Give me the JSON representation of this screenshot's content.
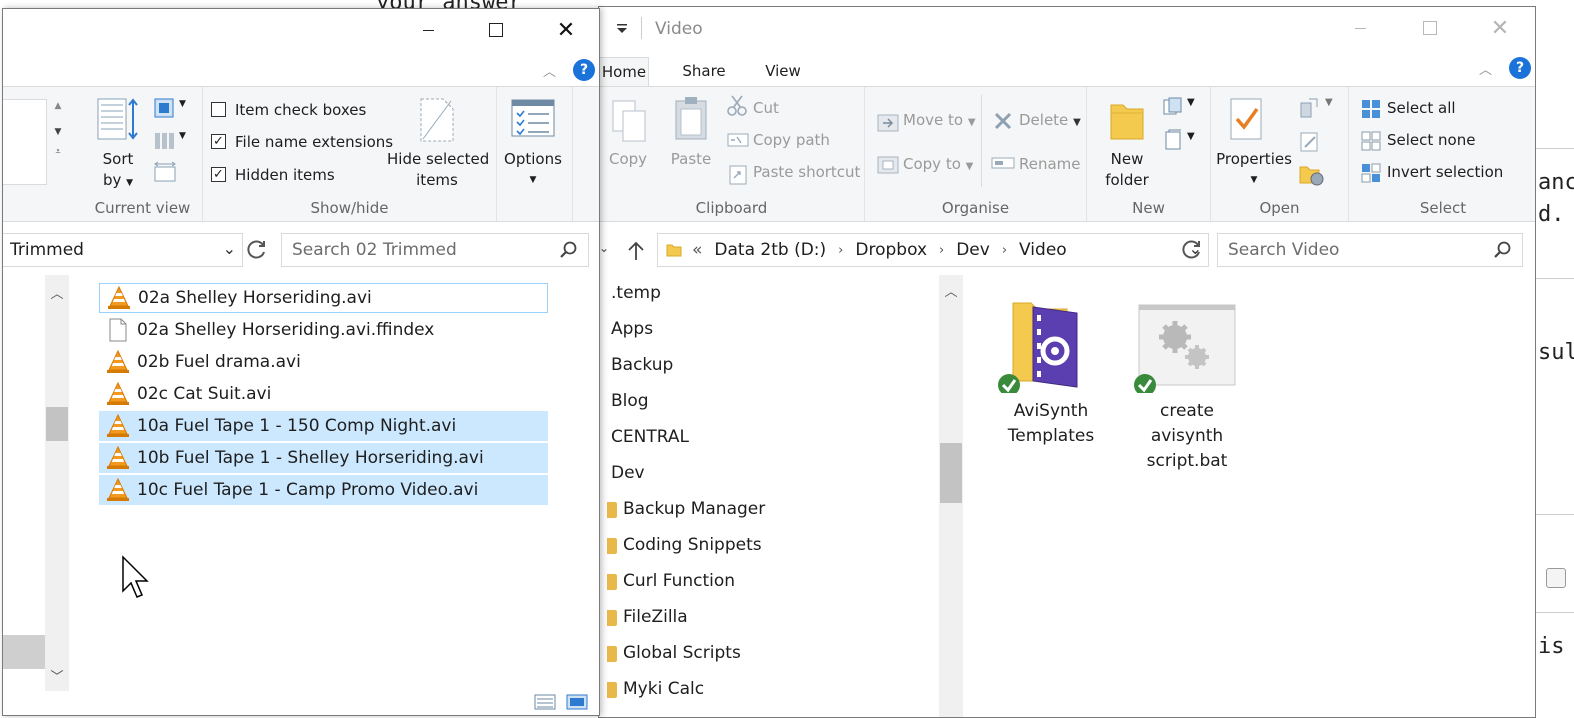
{
  "left_window": {
    "caption_minimize": "minimize",
    "caption_maximize": "maximize",
    "caption_close": "close",
    "help": "?",
    "ribbon": {
      "current_view": {
        "label": "Current view",
        "sort_by": "Sort",
        "sort_by_2": "by"
      },
      "show_hide": {
        "label": "Show/hide",
        "item_check_boxes": "Item check boxes",
        "file_name_extensions": "File name extensions",
        "hidden_items": "Hidden items",
        "hide_selected_1": "Hide selected",
        "hide_selected_2": "items",
        "checked": [
          false,
          true,
          true
        ]
      },
      "options": "Options"
    },
    "address_value": "Trimmed",
    "search_placeholder": "Search 02 Trimmed",
    "files": [
      {
        "name": "02a Shelley Horseriding.avi",
        "icon": "vlc-cone-icon",
        "selected": false,
        "focused": true
      },
      {
        "name": "02a Shelley Horseriding.avi.ffindex",
        "icon": "blank-file-icon",
        "selected": false,
        "focused": false
      },
      {
        "name": "02b Fuel drama.avi",
        "icon": "vlc-cone-icon",
        "selected": false,
        "focused": false
      },
      {
        "name": "02c Cat Suit.avi",
        "icon": "vlc-cone-icon",
        "selected": false,
        "focused": false
      },
      {
        "name": "10a Fuel Tape 1 - 150 Comp Night.avi",
        "icon": "vlc-cone-icon",
        "selected": true,
        "focused": false
      },
      {
        "name": "10b Fuel Tape 1 - Shelley Horseriding.avi",
        "icon": "vlc-cone-icon",
        "selected": true,
        "focused": false
      },
      {
        "name": "10c Fuel Tape 1 - Camp Promo Video.avi",
        "icon": "vlc-cone-icon",
        "selected": true,
        "focused": false
      }
    ]
  },
  "right_window": {
    "title": "Video",
    "tabs": [
      "Home",
      "Share",
      "View"
    ],
    "help": "?",
    "ribbon": {
      "clipboard": {
        "label": "Clipboard",
        "copy": "Copy",
        "paste": "Paste",
        "cut": "Cut",
        "copy_path": "Copy path",
        "paste_shortcut": "Paste shortcut"
      },
      "organise": {
        "label": "Organise",
        "move_to": "Move to",
        "copy_to": "Copy to",
        "delete": "Delete",
        "rename": "Rename"
      },
      "new": {
        "label": "New",
        "new_folder_1": "New",
        "new_folder_2": "folder"
      },
      "open": {
        "label": "Open",
        "properties": "Properties"
      },
      "select": {
        "label": "Select",
        "select_all": "Select all",
        "select_none": "Select none",
        "invert_selection": "Invert selection"
      }
    },
    "breadcrumb": [
      "«",
      "Data 2tb (D:)",
      "Dropbox",
      "Dev",
      "Video"
    ],
    "search_placeholder": "Search Video",
    "nav_items": [
      ".temp",
      "Apps",
      "Backup",
      "Blog",
      "CENTRAL",
      "Dev"
    ],
    "nav_sub_items": [
      "Backup Manager",
      "Coding Snippets",
      "Curl Function",
      "FileZilla",
      "Global Scripts",
      "Myki Calc"
    ],
    "items": [
      {
        "name_1": "AviSynth",
        "name_2": "Templates",
        "name_3": "",
        "icon": "folder-video-icon"
      },
      {
        "name_1": "create",
        "name_2": "avisynth",
        "name_3": "script.bat",
        "icon": "batch-gears-icon"
      }
    ]
  },
  "background": {
    "frag1": "your answer",
    "frag2": "anc",
    "frag3": "d.",
    "frag4": "sul",
    "frag5": "is"
  },
  "colors": {
    "selection": "#cce8ff",
    "accent": "#1a73d9",
    "ribbon_bg": "#f5f6f7",
    "sync_green": "#3a8a3c"
  }
}
